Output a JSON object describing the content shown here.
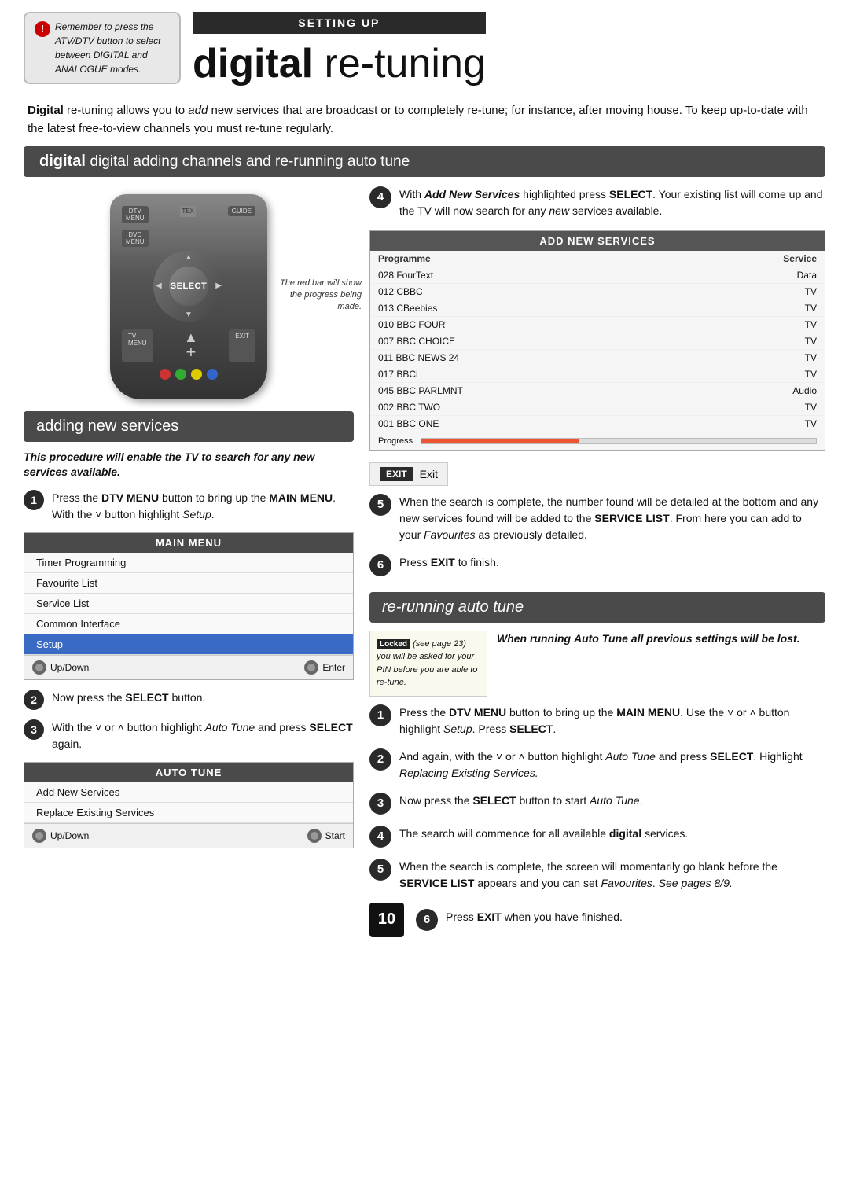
{
  "page": {
    "number": "10"
  },
  "header": {
    "remember_text": "Remember to press the ATV/DTV button to select between DIGITAL and ANALOGUE modes.",
    "setting_up": "SETTING UP",
    "title_bold": "digital",
    "title_light": " re-tuning"
  },
  "intro": {
    "text1": "Digital re-tuning allows you to add new services that are broadcast or to completely re-tune; for instance, after moving house. To keep up-to-date with the latest free-to-view channels you must re-tune regularly."
  },
  "digital_section": {
    "header": "digital adding channels and re-running auto tune"
  },
  "adding_section": {
    "header": "adding new services",
    "italic_note": "This procedure will enable the TV to search for any new services available.",
    "step1": {
      "text": "Press the DTV MENU button to bring up the MAIN MENU. With the ˅ button highlight Setup."
    },
    "main_menu": {
      "title": "MAIN MENU",
      "items": [
        "Timer Programming",
        "Favourite List",
        "Service List",
        "Common Interface",
        "Setup"
      ],
      "highlighted_item": "Setup",
      "footer_left": "Up/Down",
      "footer_right": "Enter"
    },
    "step2": {
      "text": "Now press the SELECT button."
    },
    "step3": {
      "text": "With the ˅ or ˄ button highlight Auto Tune and press SELECT again."
    },
    "auto_tune": {
      "title": "AUTO TUNE",
      "items": [
        "Add New Services",
        "Replace Existing Services"
      ],
      "footer_left": "Up/Down",
      "footer_right": "Start"
    }
  },
  "right_section": {
    "step4": {
      "text": "With Add New Services highlighted press SELECT. Your existing list will come up and the TV will now search for any new services available."
    },
    "add_new_services": {
      "title": "ADD NEW SERVICES",
      "col1": "Programme",
      "col2": "Service",
      "rows": [
        {
          "prog": "028  FourText",
          "service": "Data"
        },
        {
          "prog": "012  CBBC",
          "service": "TV"
        },
        {
          "prog": "013  CBeebies",
          "service": "TV"
        },
        {
          "prog": "010  BBC FOUR",
          "service": "TV"
        },
        {
          "prog": "007  BBC CHOICE",
          "service": "TV"
        },
        {
          "prog": "011  BBC NEWS 24",
          "service": "TV"
        },
        {
          "prog": "017  BBCi",
          "service": "TV"
        },
        {
          "prog": "045  BBC PARLMNT",
          "service": "Audio"
        },
        {
          "prog": "002  BBC TWO",
          "service": "TV"
        },
        {
          "prog": "001  BBC ONE",
          "service": "TV"
        }
      ],
      "progress_label": "Progress",
      "red_bar_note": "The red bar will show the progress being made."
    },
    "exit_label": "EXIT",
    "exit_text": "Exit",
    "step5": {
      "text": "When the search is complete, the number found will be detailed at the bottom and any new services found will be added to the SERVICE LIST. From here you can add to your Favourites as previously detailed."
    },
    "step6": {
      "text": "Press EXIT to finish."
    }
  },
  "rerun_section": {
    "header": "re-running auto tune",
    "locked_note": "If any station is Locked (see page 23) you will be asked for your PIN before you are able to re-tune.",
    "when_running_note": "When running Auto Tune all previous settings will be lost.",
    "step1": {
      "text": "Press the DTV MENU button to bring up the MAIN MENU. Use the ˅ or ˄ button highlight Setup. Press SELECT."
    },
    "step2": {
      "text": "And again, with the ˅ or ˄ button highlight Auto Tune and press SELECT. Highlight Replacing Existing Services."
    },
    "step3": {
      "text": "Now press the SELECT button to start Auto Tune."
    },
    "step4": {
      "text": "The search will commence for all available digital services."
    },
    "step5": {
      "text": "When the search is complete, the screen will momentarily go blank before the SERVICE LIST appears and you can set Favourites. See pages 8/9."
    },
    "step6": {
      "text": "Press EXIT when you have finished."
    }
  }
}
